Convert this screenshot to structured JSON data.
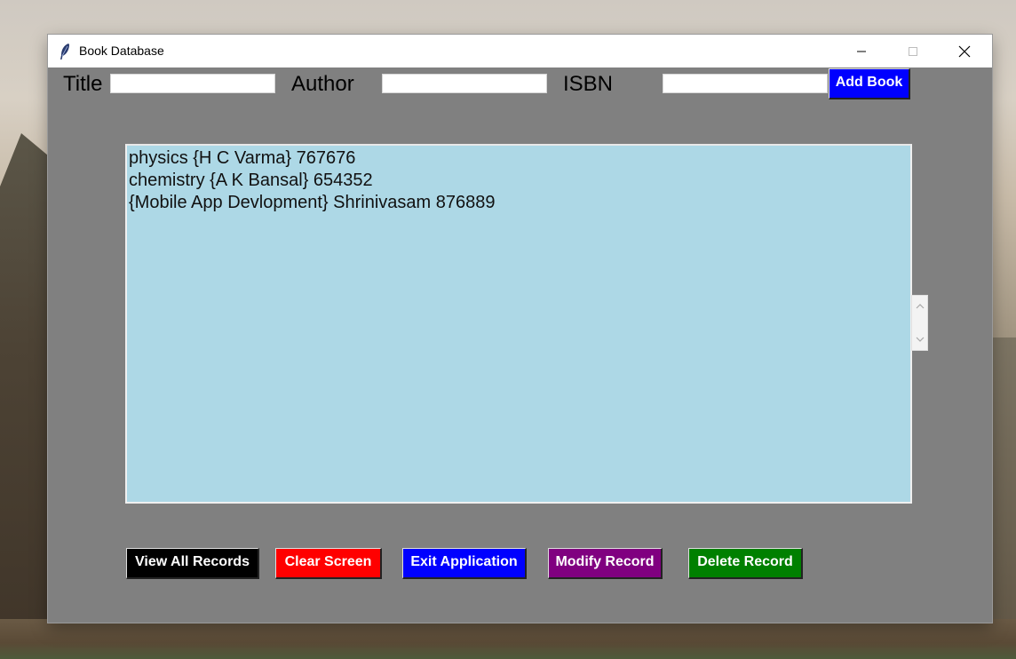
{
  "window": {
    "title": "Book Database",
    "icon": "feather-icon"
  },
  "form": {
    "title_label": "Title",
    "title_value": "",
    "author_label": "Author",
    "author_value": "",
    "isbn_label": "ISBN",
    "isbn_value": "",
    "add_button": "Add Book"
  },
  "records": [
    "physics {H C Varma} 767676",
    "chemistry {A K Bansal} 654352",
    "{Mobile App Devlopment} Shrinivasam 876889"
  ],
  "actions": {
    "view_all": "View All Records",
    "clear": "Clear Screen",
    "exit": "Exit Application",
    "modify": "Modify Record",
    "delete": "Delete Record"
  },
  "colors": {
    "window_bg": "#808080",
    "listbox_bg": "#add8e6",
    "add_button": "#0000ff",
    "view_all": "#000000",
    "clear": "#ff0000",
    "exit": "#0000ff",
    "modify": "#800080",
    "delete": "#008000"
  }
}
